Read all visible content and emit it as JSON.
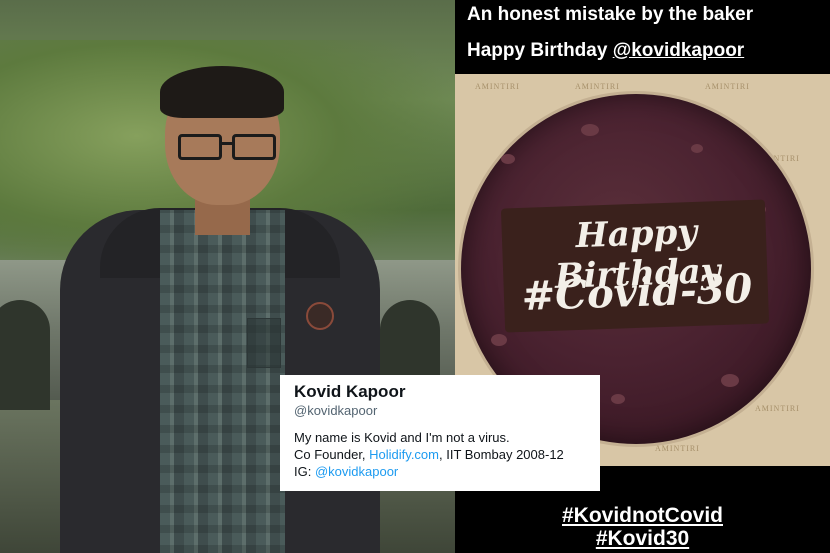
{
  "story": {
    "caption_line1": "An honest mistake by the baker",
    "caption_line2_prefix": "Happy Birthday ",
    "caption_line2_mention": "@kovidkapoor",
    "cake_brand": "AMINTIRI",
    "cake_message_line1": "Happy Birthday",
    "cake_message_line2": "#Covid-30",
    "hashtag1": "#KovidnotCovid",
    "hashtag2": "#Kovid30"
  },
  "profile_card": {
    "name": "Kovid Kapoor",
    "handle": "@kovidkapoor",
    "bio_line1": "My name is Kovid and I'm not a virus.",
    "bio_line2_prefix": "Co Founder, ",
    "bio_line2_link": "Holidify.com",
    "bio_line2_suffix": ", IIT Bombay 2008-12",
    "bio_line3_prefix": "IG: ",
    "bio_line3_link": "@kovidkapoor",
    "link_color": "#1d9bf0"
  }
}
